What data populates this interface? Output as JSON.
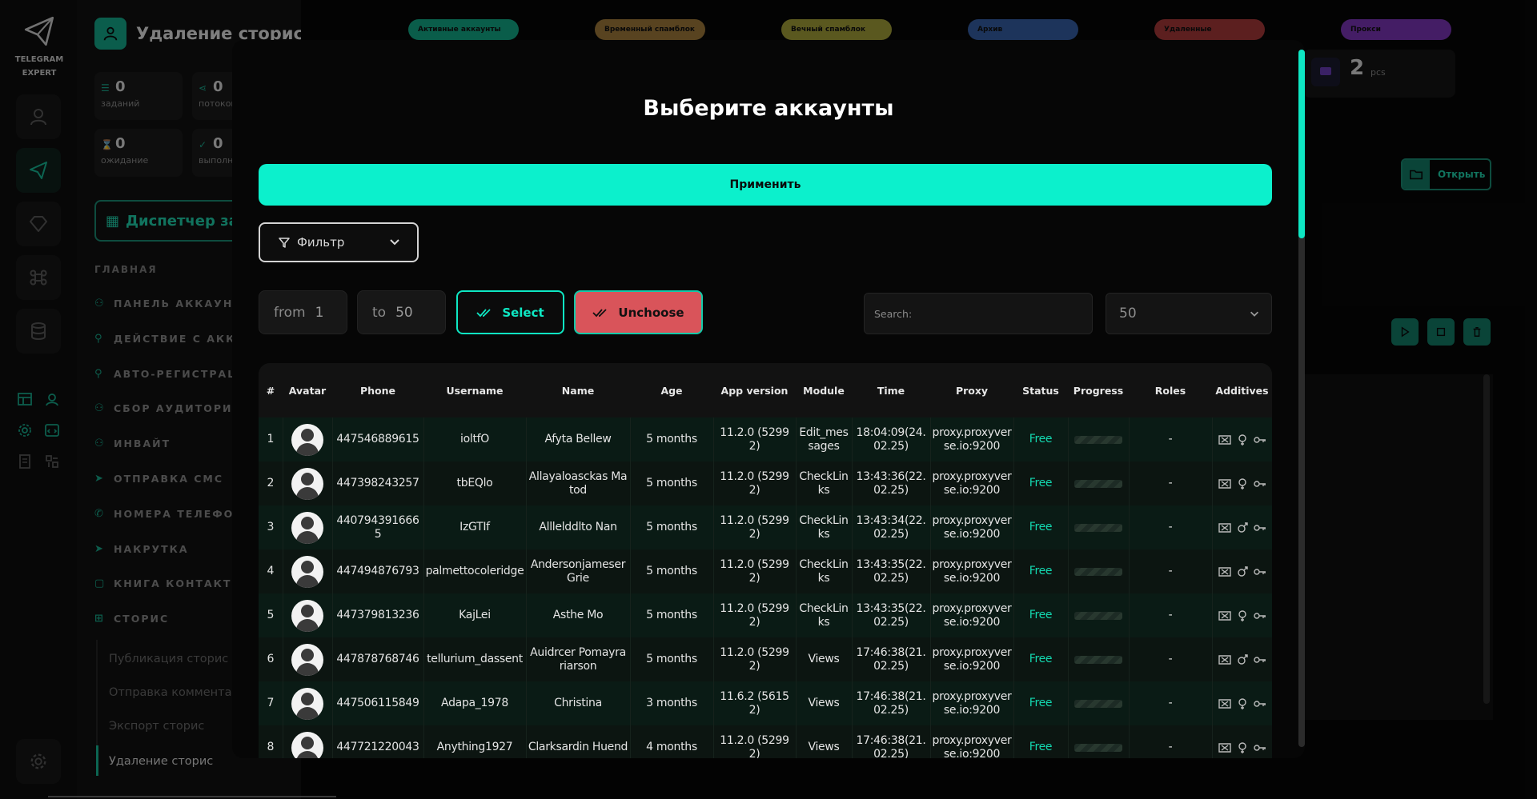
{
  "app": {
    "logo_text_1": "TELEGRAM",
    "logo_text_2": "EXPERT",
    "page_title": "Удаление сторис"
  },
  "stats": [
    {
      "value": "0",
      "label": "заданий"
    },
    {
      "value": "0",
      "label": "потоков"
    },
    {
      "value": "0",
      "label": "ожидание"
    },
    {
      "value": "0",
      "label": "выполнено"
    }
  ],
  "sidebar": {
    "dispatcher_label": "Диспетчер задач",
    "section_main": "ГЛАВНАЯ",
    "items": [
      {
        "label": "ПАНЕЛЬ АККАУНТОВ",
        "icon": "accounts-icon"
      },
      {
        "label": "ДЕЙСТВИЕ С АККАУНТАМИ",
        "icon": "user-icon"
      },
      {
        "label": "АВТО-РЕГИСТРАЦИЯ",
        "icon": "user-plus-icon"
      },
      {
        "label": "СБОР АУДИТОРИИ",
        "icon": "users-icon"
      },
      {
        "label": "ИНВАЙТ",
        "icon": "invite-icon"
      },
      {
        "label": "ОТПРАВКА СМС",
        "icon": "send-icon"
      },
      {
        "label": "НОМЕРА ТЕЛЕФОНОВ",
        "icon": "phone-icon"
      },
      {
        "label": "НАКРУТКА",
        "icon": "boost-icon"
      },
      {
        "label": "КНИГА КОНТАКТОВ",
        "icon": "book-icon"
      },
      {
        "label": "СТОРИС",
        "icon": "plus-square-icon"
      }
    ],
    "sub_items": [
      {
        "label": "Публикация сторис"
      },
      {
        "label": "Отправка комментариев"
      },
      {
        "label": "Экспорт сторис"
      },
      {
        "label": "Удаление сторис"
      }
    ]
  },
  "tabs": [
    {
      "label": "Активные аккаунты",
      "color": "#13a987"
    },
    {
      "label": "Временный спамблок",
      "color": "#a07a3b"
    },
    {
      "label": "Вечный спамблок",
      "color": "#a4a03a"
    },
    {
      "label": "Архив",
      "color": "#355fa6"
    },
    {
      "label": "Удаленные",
      "color": "#a8393a"
    },
    {
      "label": "Прокси",
      "color": "#7d35b8"
    }
  ],
  "background": {
    "count_value": "2",
    "count_unit": "pcs",
    "open_label": "Открыть"
  },
  "modal": {
    "title": "Выберите аккаунты",
    "apply_label": "Применить",
    "filter_label": "Фильтр",
    "from_label": "from",
    "from_value": "1",
    "to_label": "to",
    "to_value": "50",
    "select_label": "Select",
    "unchoose_label": "Unchoose",
    "search_placeholder": "Search:",
    "per_page": "50",
    "columns": [
      "#",
      "Avatar",
      "Phone",
      "Username",
      "Name",
      "Age",
      "App version",
      "Module",
      "Time",
      "Proxy",
      "Status",
      "Progress",
      "Roles",
      "Additives"
    ],
    "rows": [
      {
        "num": "1",
        "phone": "447546889615",
        "username": "ioltfO",
        "name": "Afyta Bellew",
        "age": "5 months",
        "app": "11.2.0 (52992)",
        "module": "Edit_messages",
        "time": "18:04:09(24.02.25)",
        "proxy": "proxy.proxyverse.io:9200",
        "status": "Free",
        "roles": "-",
        "gender": "female"
      },
      {
        "num": "2",
        "phone": "447398243257",
        "username": "tbEQlo",
        "name": "Allayaloasckas Matod",
        "age": "5 months",
        "app": "11.2.0 (52992)",
        "module": "CheckLinks",
        "time": "13:43:36(22.02.25)",
        "proxy": "proxy.proxyverse.io:9200",
        "status": "Free",
        "roles": "-",
        "gender": "female"
      },
      {
        "num": "3",
        "phone": "4407943916665",
        "username": "IzGTIf",
        "name": "Alllelddlto Nan",
        "age": "5 months",
        "app": "11.2.0 (52992)",
        "module": "CheckLinks",
        "time": "13:43:34(22.02.25)",
        "proxy": "proxy.proxyverse.io:9200",
        "status": "Free",
        "roles": "-",
        "gender": "male"
      },
      {
        "num": "4",
        "phone": "447494876793",
        "username": "palmettocoleridge",
        "name": "Andersonjameser Grie",
        "age": "5 months",
        "app": "11.2.0 (52992)",
        "module": "CheckLinks",
        "time": "13:43:35(22.02.25)",
        "proxy": "proxy.proxyverse.io:9200",
        "status": "Free",
        "roles": "-",
        "gender": "male"
      },
      {
        "num": "5",
        "phone": "447379813236",
        "username": "KajLei",
        "name": "Asthe Mo",
        "age": "5 months",
        "app": "11.2.0 (52992)",
        "module": "CheckLinks",
        "time": "13:43:35(22.02.25)",
        "proxy": "proxy.proxyverse.io:9200",
        "status": "Free",
        "roles": "-",
        "gender": "female"
      },
      {
        "num": "6",
        "phone": "447878768746",
        "username": "tellurium_dassent",
        "name": "Auidrcer Pomayrariarson",
        "age": "5 months",
        "app": "11.2.0 (52992)",
        "module": "Views",
        "time": "17:46:38(21.02.25)",
        "proxy": "proxy.proxyverse.io:9200",
        "status": "Free",
        "roles": "-",
        "gender": "male"
      },
      {
        "num": "7",
        "phone": "447506115849",
        "username": "Adapa_1978",
        "name": "Christina",
        "age": "3 months",
        "app": "11.6.2 (56152)",
        "module": "Views",
        "time": "17:46:38(21.02.25)",
        "proxy": "proxy.proxyverse.io:9200",
        "status": "Free",
        "roles": "-",
        "gender": "female"
      },
      {
        "num": "8",
        "phone": "447721220043",
        "username": "Anything1927",
        "name": "Clarksardin Huend",
        "age": "4 months",
        "app": "11.2.0 (52992)",
        "module": "Views",
        "time": "17:46:38(21.02.25)",
        "proxy": "proxy.proxyverse.io:9200",
        "status": "Free",
        "roles": "-",
        "gender": "female"
      }
    ]
  }
}
